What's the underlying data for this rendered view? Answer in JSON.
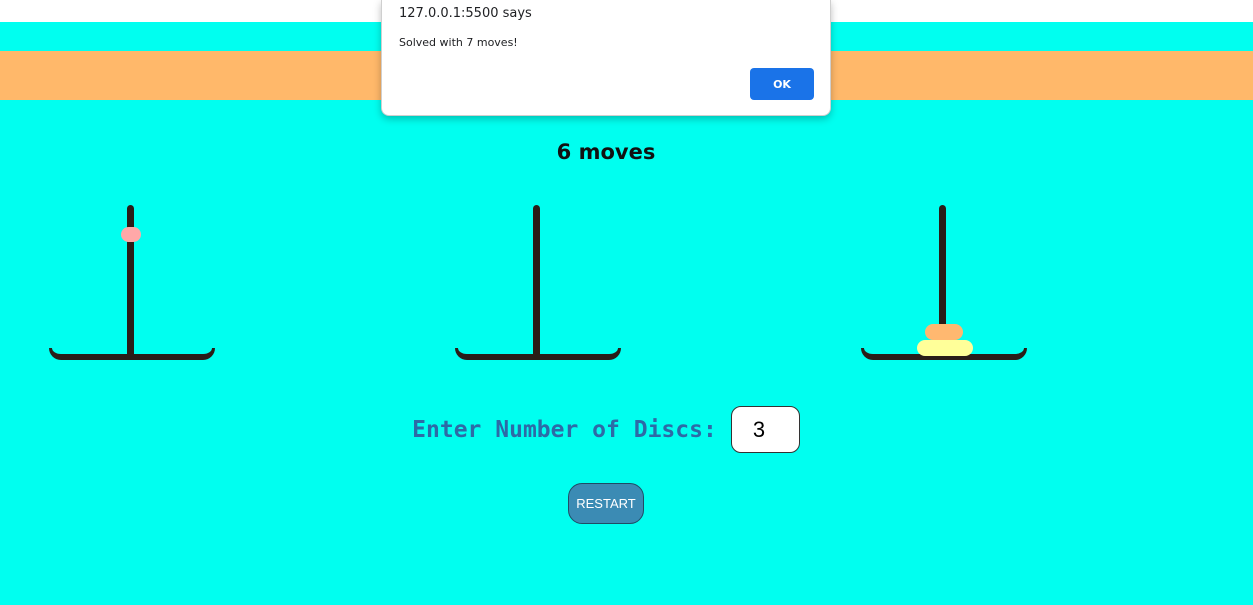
{
  "game": {
    "moves_label": "6 moves",
    "towers": [
      {
        "name": "left",
        "discs": [
          {
            "size": 1,
            "color": "#ffa8a8"
          }
        ]
      },
      {
        "name": "middle",
        "discs": []
      },
      {
        "name": "right",
        "discs": [
          {
            "size": 2,
            "color": "#ffb870"
          },
          {
            "size": 3,
            "color": "#ffff99"
          }
        ]
      }
    ]
  },
  "controls": {
    "disc_label": "Enter Number of Discs:",
    "disc_count_value": "3",
    "restart_label": "RESTART"
  },
  "alert": {
    "origin": "127.0.0.1:5500 says",
    "message": "Solved with 7 moves!",
    "ok_label": "OK"
  },
  "colors": {
    "background": "#00fff0",
    "header_band": "#ffb86a",
    "rod": "#2a1d18",
    "restart_button": "#3b8bb4",
    "ok_button": "#1a73e8"
  }
}
